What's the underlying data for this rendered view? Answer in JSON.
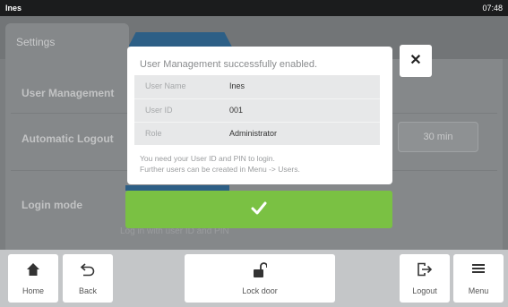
{
  "status_bar": {
    "user": "Ines",
    "time": "07:48"
  },
  "settings": {
    "tab_title": "Settings",
    "rows": [
      {
        "label": "User Management"
      },
      {
        "label": "Automatic Logout",
        "value": "30 min"
      },
      {
        "label": "Login mode",
        "hint": "Log in with user ID and PIN"
      }
    ]
  },
  "dialog": {
    "message": "User Management successfully enabled.",
    "fields": [
      {
        "label": "User Name",
        "value": "Ines"
      },
      {
        "label": "User ID",
        "value": "001"
      },
      {
        "label": "Role",
        "value": "Administrator"
      }
    ],
    "hint_line1": "You need your User ID and PIN to login.",
    "hint_line2": "Further users can be created in Menu -> Users.",
    "close_icon": "close-icon",
    "confirm_icon": "checkmark-icon",
    "confirm_color": "#7ac143"
  },
  "bottom_nav": {
    "home": "Home",
    "back": "Back",
    "lock_door": "Lock door",
    "logout": "Logout",
    "menu": "Menu"
  },
  "colors": {
    "accent": "#2d5f86",
    "confirm": "#7ac143",
    "status_bar": "#1b1c1d"
  }
}
